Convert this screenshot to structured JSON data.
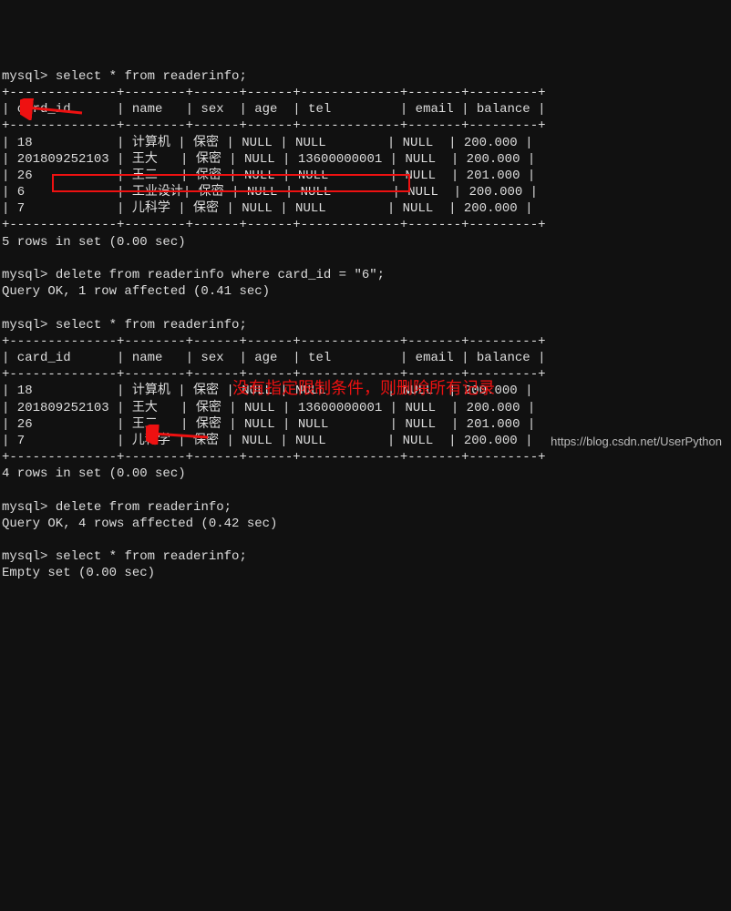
{
  "prompt": "mysql>",
  "queries": {
    "select1": "select * from readerinfo;",
    "delete_where": "delete from readerinfo where card_id = \"6\";",
    "delete_where_result": "Query OK, 1 row affected (0.41 sec)",
    "select2": "select * from readerinfo;",
    "delete_all": "delete from readerinfo;",
    "delete_all_result": "Query OK, 4 rows affected (0.42 sec)",
    "select3": "select * from readerinfo;",
    "empty_result": "Empty set (0.00 sec)"
  },
  "table": {
    "sep_top": "+--------------+--------+------+------+-------------+-------+---------+",
    "header_row": "| card_id      | name   | sex  | age  | tel         | email | balance |",
    "sep_mid": "+--------------+--------+------+------+-------------+-------+---------+",
    "rows1": [
      "| 18           | 计算机 | 保密 | NULL | NULL        | NULL  | 200.000 |",
      "| 201809252103 | 王大   | 保密 | NULL | 13600000001 | NULL  | 200.000 |",
      "| 26           | 王二   | 保密 | NULL | NULL        | NULL  | 201.000 |",
      "| 6            | 工业设计| 保密 | NULL | NULL        | NULL  | 200.000 |",
      "| 7            | 儿科学 | 保密 | NULL | NULL        | NULL  | 200.000 |"
    ],
    "rows2": [
      "| 18           | 计算机 | 保密 | NULL | NULL        | NULL  | 200.000 |",
      "| 201809252103 | 王大   | 保密 | NULL | 13600000001 | NULL  | 200.000 |",
      "| 26           | 王二   | 保密 | NULL | NULL        | NULL  | 201.000 |",
      "| 7            | 儿科学 | 保密 | NULL | NULL        | NULL  | 200.000 |"
    ],
    "sep_bot": "+--------------+--------+------+------+-------------+-------+---------+",
    "rows1_summary": "5 rows in set (0.00 sec)",
    "rows2_summary": "4 rows in set (0.00 sec)"
  },
  "annotation": {
    "comment": "没有指定限制条件，则删除所有记录"
  },
  "watermark": "https://blog.csdn.net/UserPython",
  "chart_data": {
    "type": "table",
    "title": "readerinfo",
    "columns": [
      "card_id",
      "name",
      "sex",
      "age",
      "tel",
      "email",
      "balance"
    ],
    "before_delete": [
      {
        "card_id": "18",
        "name": "计算机",
        "sex": "保密",
        "age": null,
        "tel": null,
        "email": null,
        "balance": 200.0
      },
      {
        "card_id": "201809252103",
        "name": "王大",
        "sex": "保密",
        "age": null,
        "tel": "13600000001",
        "email": null,
        "balance": 200.0
      },
      {
        "card_id": "26",
        "name": "王二",
        "sex": "保密",
        "age": null,
        "tel": null,
        "email": null,
        "balance": 201.0
      },
      {
        "card_id": "6",
        "name": "工业设计",
        "sex": "保密",
        "age": null,
        "tel": null,
        "email": null,
        "balance": 200.0
      },
      {
        "card_id": "7",
        "name": "儿科学",
        "sex": "保密",
        "age": null,
        "tel": null,
        "email": null,
        "balance": 200.0
      }
    ],
    "after_delete_where": [
      {
        "card_id": "18",
        "name": "计算机",
        "sex": "保密",
        "age": null,
        "tel": null,
        "email": null,
        "balance": 200.0
      },
      {
        "card_id": "201809252103",
        "name": "王大",
        "sex": "保密",
        "age": null,
        "tel": "13600000001",
        "email": null,
        "balance": 200.0
      },
      {
        "card_id": "26",
        "name": "王二",
        "sex": "保密",
        "age": null,
        "tel": null,
        "email": null,
        "balance": 201.0
      },
      {
        "card_id": "7",
        "name": "儿科学",
        "sex": "保密",
        "age": null,
        "tel": null,
        "email": null,
        "balance": 200.0
      }
    ],
    "after_delete_all": []
  }
}
